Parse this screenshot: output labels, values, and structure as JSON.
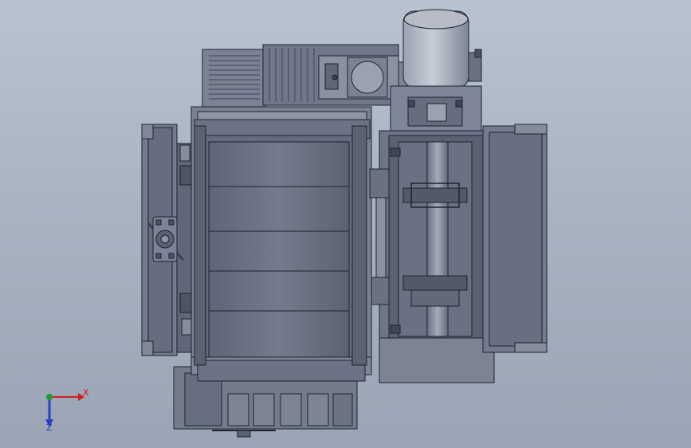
{
  "viewport": {
    "background_top": "#b9c2d0",
    "background_bottom": "#9aa4b4",
    "part_fill": "#6e7688",
    "part_fill_light": "#878fa0",
    "part_fill_dark": "#505868",
    "edge_color": "#1c2230"
  },
  "triad": {
    "x_label": "X",
    "z_label": "Z",
    "x_color": "#d02020",
    "y_color": "#1f9a32",
    "z_color": "#2a3fc8"
  }
}
